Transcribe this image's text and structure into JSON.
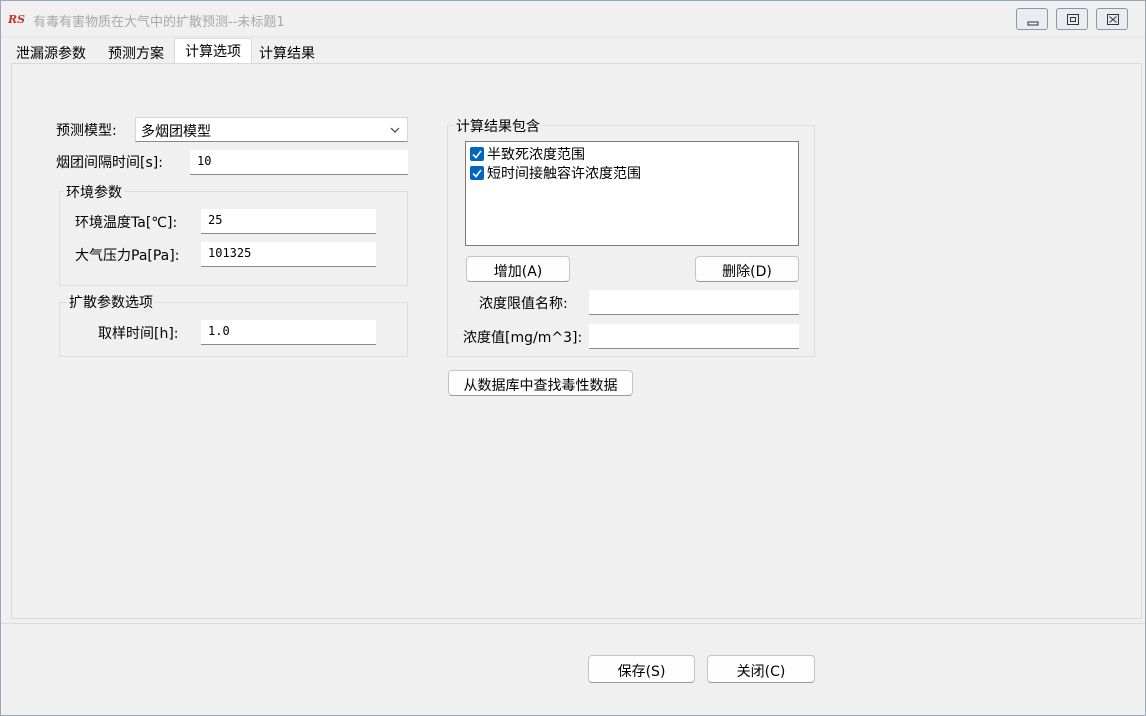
{
  "window": {
    "title": "有毒有害物质在大气中的扩散预测--未标题1",
    "controls": {
      "minimize": "minimize-icon",
      "maximize": "maximize-icon",
      "close": "close-icon"
    }
  },
  "tabs": [
    {
      "label": "泄漏源参数",
      "active": false
    },
    {
      "label": "预测方案",
      "active": false
    },
    {
      "label": "计算选项",
      "active": true
    },
    {
      "label": "计算结果",
      "active": false
    }
  ],
  "left": {
    "model_label": "预测模型:",
    "model_value": "多烟团模型",
    "interval_label": "烟团间隔时间[s]:",
    "interval_value": "10",
    "env_group_title": "环境参数",
    "temp_label": "环境温度Ta[℃]:",
    "temp_value": "25",
    "pressure_label": "大气压力Pa[Pa]:",
    "pressure_value": "101325",
    "diff_group_title": "扩散参数选项",
    "sample_label": "取样时间[h]:",
    "sample_value": "1.0"
  },
  "right": {
    "group_title": "计算结果包含",
    "items": [
      {
        "label": "半致死浓度范围",
        "checked": true
      },
      {
        "label": "短时间接触容许浓度范围",
        "checked": true
      }
    ],
    "add_button": "增加(A)",
    "delete_button": "删除(D)",
    "name_label": "浓度限值名称:",
    "name_value": "",
    "value_label": "浓度值[mg/m^3]:",
    "value_value": "",
    "db_button": "从数据库中查找毒性数据"
  },
  "footer": {
    "save_button": "保存(S)",
    "close_button": "关闭(C)"
  },
  "colors": {
    "accent": "#0067c0",
    "window_bg": "#f0f0f0",
    "title_text": "#a8a8a8",
    "app_icon": "#c0392b"
  }
}
